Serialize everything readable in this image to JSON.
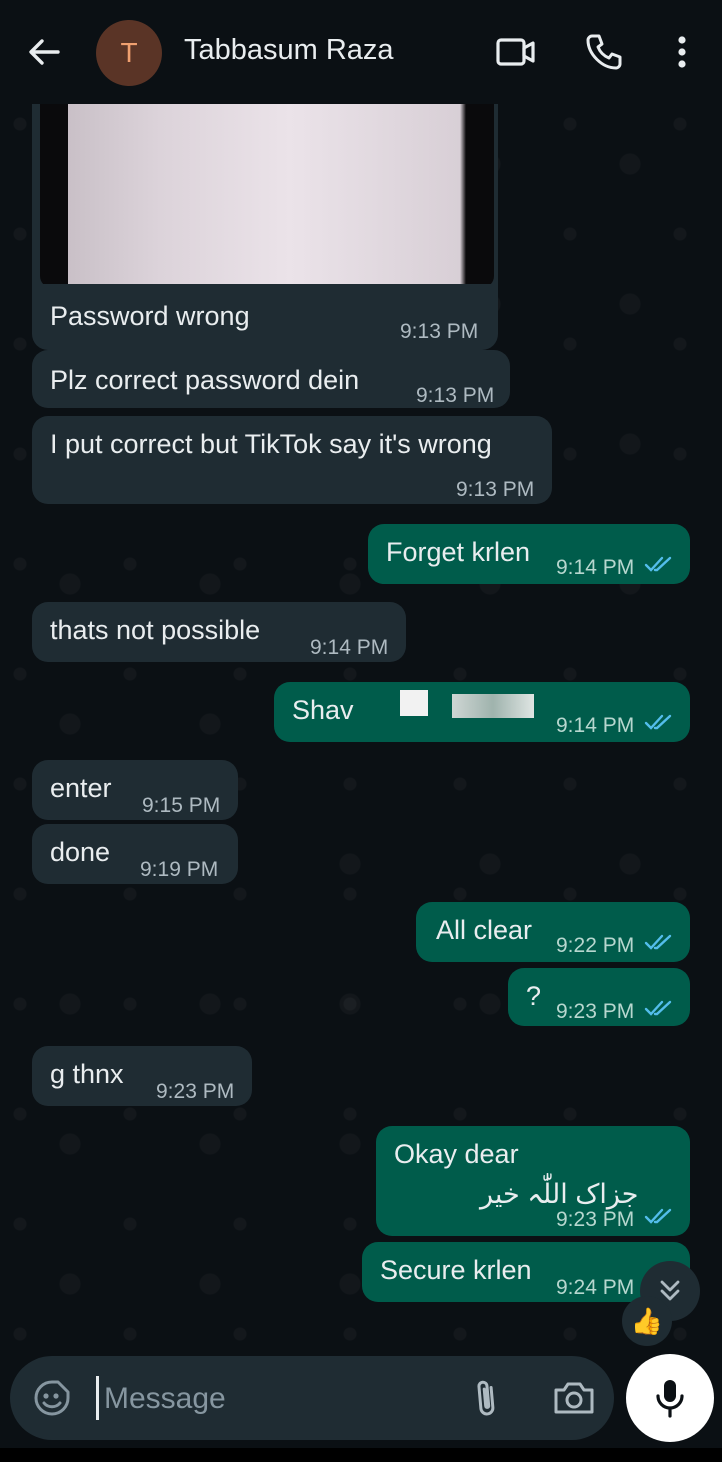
{
  "header": {
    "avatar_initial": "T",
    "contact_name": "Tabbasum Raza"
  },
  "messages": [
    {
      "dir": "in",
      "text": "Password wrong",
      "time": "9:13 PM"
    },
    {
      "dir": "in",
      "text": "Plz correct password dein",
      "time": "9:13 PM"
    },
    {
      "dir": "in",
      "text": "I put correct but TikTok say it's wrong",
      "time": "9:13 PM"
    },
    {
      "dir": "out",
      "text": "Forget krlen",
      "time": "9:14 PM",
      "read": true
    },
    {
      "dir": "in",
      "text": "thats not possible",
      "time": "9:14 PM"
    },
    {
      "dir": "out",
      "text": "Shav",
      "time": "9:14 PM",
      "read": true
    },
    {
      "dir": "in",
      "text": "enter",
      "time": "9:15 PM"
    },
    {
      "dir": "in",
      "text": "done",
      "time": "9:19 PM"
    },
    {
      "dir": "out",
      "text": "All clear",
      "time": "9:22 PM",
      "read": true
    },
    {
      "dir": "out",
      "text": "?",
      "time": "9:23 PM",
      "read": true
    },
    {
      "dir": "in",
      "text": "g thnx",
      "time": "9:23 PM"
    },
    {
      "dir": "out",
      "text": "Okay dear",
      "text2": "جزاک اللّٰہ خیر",
      "time": "9:23 PM",
      "read": true
    },
    {
      "dir": "out",
      "text": "Secure krlen",
      "time": "9:24 PM",
      "read": true
    }
  ],
  "reaction_emoji": "👍",
  "composer": {
    "placeholder": "Message"
  },
  "colors": {
    "incoming_bubble": "#1f2c33",
    "outgoing_bubble": "#005c4b",
    "read_ticks": "#53bdeb",
    "background": "#0b1014"
  },
  "icons": [
    "back-arrow-icon",
    "video-call-icon",
    "voice-call-icon",
    "more-options-icon",
    "emoji-sticker-icon",
    "attach-icon",
    "camera-icon",
    "mic-icon",
    "scroll-down-icon",
    "read-ticks-icon"
  ]
}
